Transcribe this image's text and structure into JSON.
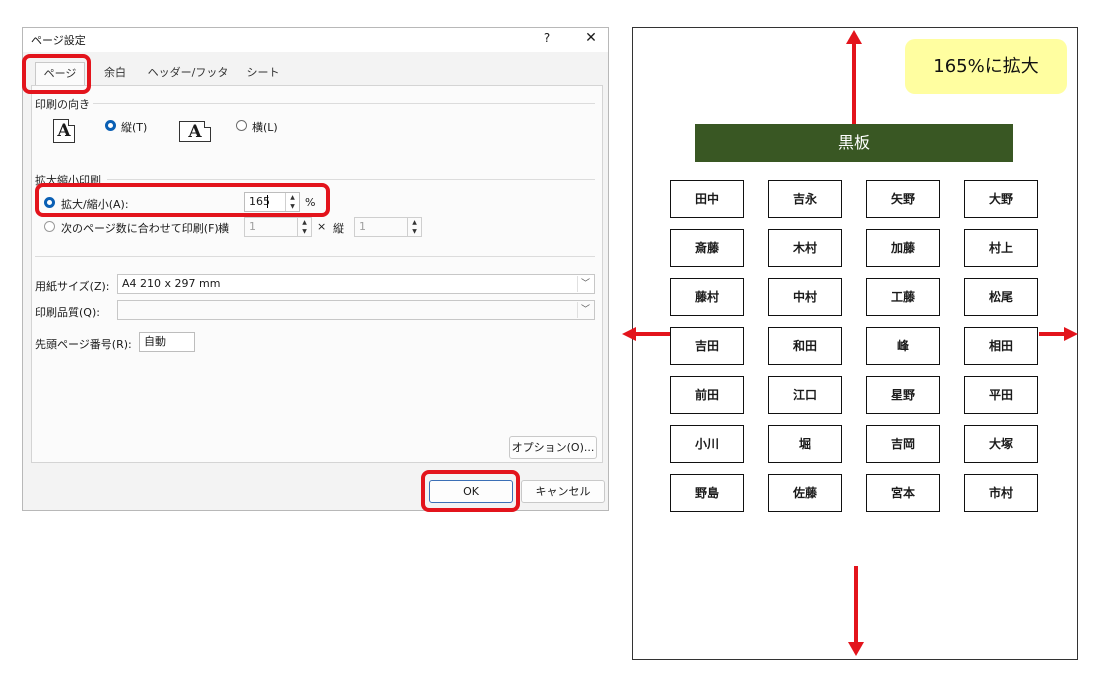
{
  "dialog": {
    "title": "ページ設定",
    "help_label": "?",
    "close_label": "✕",
    "tabs": [
      {
        "label": "ページ"
      },
      {
        "label": "余白"
      },
      {
        "label": "ヘッダー/フッター"
      },
      {
        "label": "シート"
      }
    ],
    "orientation": {
      "heading": "印刷の向き",
      "portrait_label": "縦(T)",
      "landscape_label": "横(L)",
      "icon_glyph": "A",
      "selected": "portrait"
    },
    "scaling": {
      "heading": "拡大縮小印刷",
      "adjust_label": "拡大/縮小(A):",
      "adjust_value": "165",
      "adjust_unit": "%",
      "fit_label": "次のページ数に合わせて印刷(F):",
      "fit_wide_label": "横",
      "fit_wide_value": "1",
      "fit_times": "×",
      "fit_tall_label": "縦",
      "fit_tall_value": "1",
      "selected": "adjust"
    },
    "paper_size": {
      "label": "用紙サイズ(Z):",
      "value": "A4 210 x 297 mm"
    },
    "print_quality": {
      "label": "印刷品質(Q):",
      "value": ""
    },
    "first_page_number": {
      "label": "先頭ページ番号(R):",
      "value": "自動"
    },
    "options_label": "オプション(O)...",
    "ok_label": "OK",
    "cancel_label": "キャンセル"
  },
  "chart": {
    "zoom_note": "165%に拡大",
    "blackboard": "黒板",
    "seats": [
      [
        "田中",
        "吉永",
        "矢野",
        "大野"
      ],
      [
        "斎藤",
        "木村",
        "加藤",
        "村上"
      ],
      [
        "藤村",
        "中村",
        "工藤",
        "松尾"
      ],
      [
        "吉田",
        "和田",
        "峰",
        "相田"
      ],
      [
        "前田",
        "江口",
        "星野",
        "平田"
      ],
      [
        "小川",
        "堀",
        "吉岡",
        "大塚"
      ],
      [
        "野島",
        "佐藤",
        "宮本",
        "市村"
      ]
    ]
  },
  "colors": {
    "highlight": "#e3141c",
    "blackboard": "#395723",
    "zoom_note_bg": "#fffea0",
    "radio_checked": "#0a5fb4"
  }
}
